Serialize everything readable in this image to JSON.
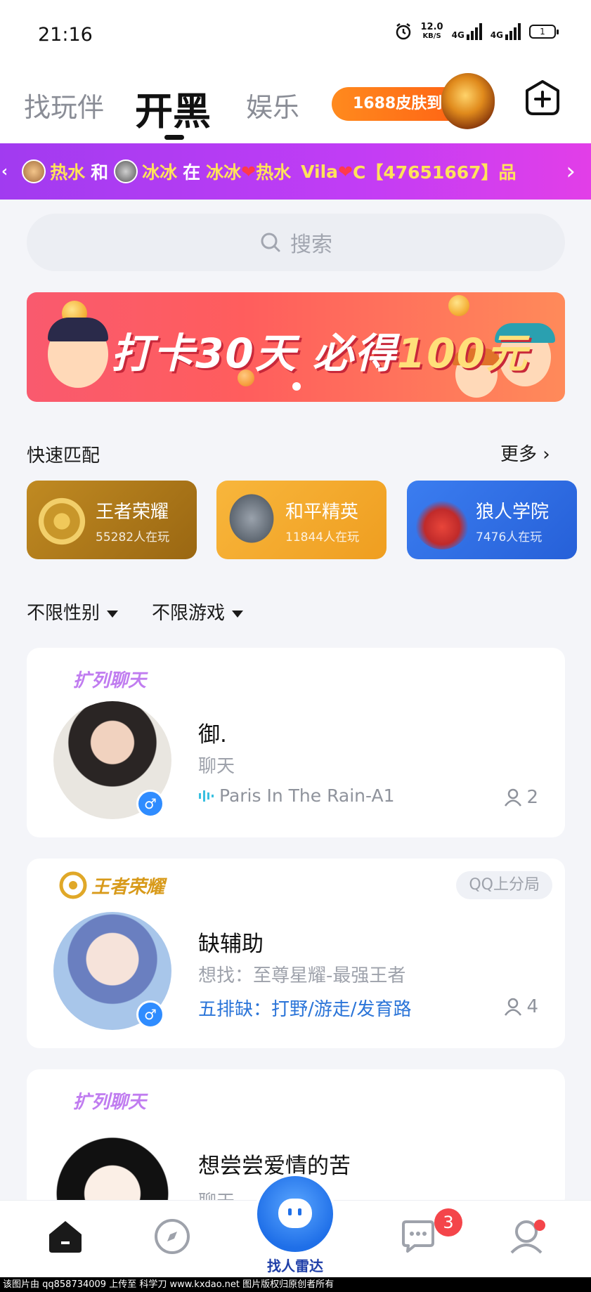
{
  "status_bar": {
    "time": "21:16",
    "speed_value": "12.0",
    "speed_unit": "KB/S",
    "net1": "4G",
    "net2": "4G",
    "battery": "1"
  },
  "top_nav": {
    "tabs": [
      {
        "label": "找玩伴",
        "active": false
      },
      {
        "label": "开黑",
        "active": true
      },
      {
        "label": "娱乐",
        "active": false
      }
    ],
    "promo_label": "1688皮肤到"
  },
  "ticker": {
    "user1": "热水",
    "and": "和",
    "user2": "冰冰",
    "at": "在",
    "room_prefix": "冰冰",
    "room_suffix": "热水",
    "room_name_a": "Vila",
    "room_name_b": "C【47651667】品"
  },
  "search": {
    "placeholder": "搜索"
  },
  "banner": {
    "text_a": "打卡30天 必得",
    "text_b": "100元"
  },
  "quick_match": {
    "title": "快速匹配",
    "more_label": "更多",
    "games": [
      {
        "name": "王者荣耀",
        "players": "55282人在玩",
        "color": "#b07a17"
      },
      {
        "name": "和平精英",
        "players": "11844人在玩",
        "color": "#f2a72c"
      },
      {
        "name": "狼人学院",
        "players": "7476人在玩",
        "color": "#2f6fe0"
      }
    ]
  },
  "filters": {
    "gender": "不限性别",
    "game": "不限游戏"
  },
  "cards": [
    {
      "tag": "扩列聊天",
      "name": "御.",
      "subtitle": "聊天",
      "song": "Paris In The Rain-A1",
      "count": "2"
    },
    {
      "tag": "王者荣耀",
      "badge": "QQ上分局",
      "name": "缺辅助",
      "subtitle": "想找：至尊星耀-最强王者",
      "need": "五排缺：打野/游走/发育路",
      "count": "4"
    },
    {
      "tag": "扩列聊天",
      "name": "想尝尝爱情的苦",
      "subtitle": "聊天"
    }
  ],
  "bottom_nav": {
    "radar_label": "找人雷达",
    "message_badge": "3"
  },
  "watermark": "该图片由 qq858734009 上传至 科学刀 www.kxdao.net 图片版权归原创者所有"
}
